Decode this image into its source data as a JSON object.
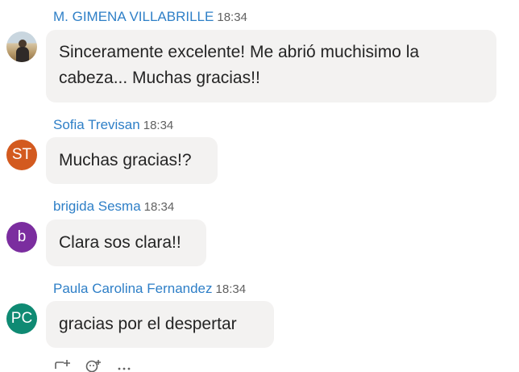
{
  "messages": [
    {
      "author": "M. GIMENA VILLABRILLE",
      "time": "18:34",
      "text": "Sinceramente excelente! Me abrió muchisimo la cabeza... Muchas gracias!!",
      "avatar": {
        "type": "photo",
        "initials": "",
        "color": "#c9d6df"
      }
    },
    {
      "author": "Sofia Trevisan",
      "time": "18:34",
      "text": "Muchas gracias!?",
      "avatar": {
        "type": "initials",
        "initials": "ST",
        "color": "#d35a1f"
      }
    },
    {
      "author": "brigida Sesma",
      "time": "18:34",
      "text": "Clara sos clara!!",
      "avatar": {
        "type": "initials",
        "initials": "b",
        "color": "#7b2d9f"
      }
    },
    {
      "author": "Paula Carolina Fernandez",
      "time": "18:34",
      "text": "gracias por el despertar",
      "avatar": {
        "type": "initials",
        "initials": "PC",
        "color": "#0f8a73"
      }
    }
  ],
  "actions": [
    {
      "name": "reply-icon",
      "glyph": "⤶"
    },
    {
      "name": "add-reaction-icon",
      "glyph": "☺"
    },
    {
      "name": "more-options-icon",
      "glyph": "···"
    }
  ],
  "colors": {
    "author": "#2e7fc7",
    "bubble": "#f3f2f1",
    "text": "#242424",
    "time": "#616161"
  }
}
